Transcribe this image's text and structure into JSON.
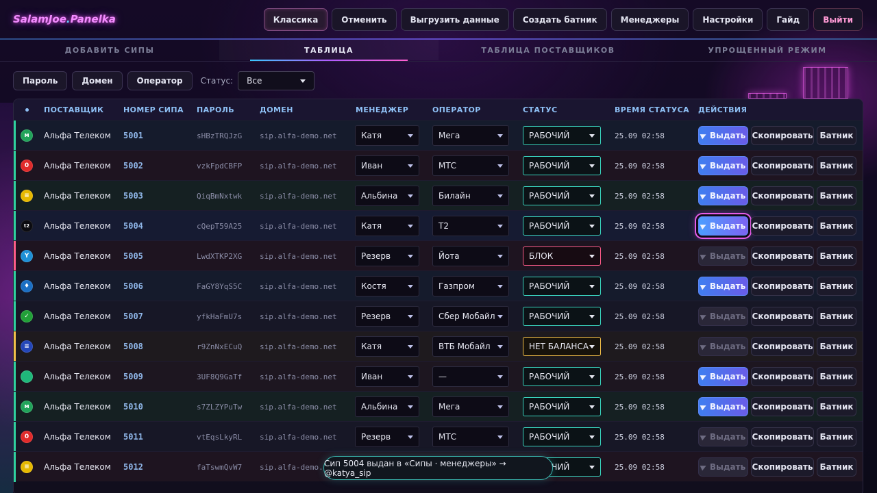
{
  "app": {
    "logo_main": "SalamJoe",
    "logo_dot": ".",
    "logo_tail": "Panelka"
  },
  "topnav": [
    {
      "id": "classic",
      "label": "Классика",
      "active": true
    },
    {
      "id": "undo",
      "label": "Отменить"
    },
    {
      "id": "export",
      "label": "Выгрузить данные"
    },
    {
      "id": "create-batnik",
      "label": "Создать батник"
    },
    {
      "id": "managers",
      "label": "Менеджеры"
    },
    {
      "id": "settings",
      "label": "Настройки"
    },
    {
      "id": "guide",
      "label": "Гайд"
    },
    {
      "id": "logout",
      "label": "Выйти"
    }
  ],
  "tabs": [
    {
      "label": "ДОБАВИТЬ СИПЫ"
    },
    {
      "label": "ТАБЛИЦА",
      "active": true
    },
    {
      "label": "ТАБЛИЦА ПОСТАВЩИКОВ"
    },
    {
      "label": "УПРОЩЕННЫЙ РЕЖИМ"
    }
  ],
  "filters": {
    "buttons": [
      "Пароль",
      "Домен",
      "Оператор"
    ],
    "status_label": "Статус:",
    "status_value": "Все"
  },
  "table": {
    "headers": [
      "•",
      "ПОСТАВЩИК",
      "НОМЕР СИПА",
      "ПАРОЛЬ",
      "ДОМЕН",
      "МЕНЕДЖЕР",
      "ОПЕРАТОР",
      "СТАТУС",
      "ВРЕМЯ СТАТУСА",
      "ДЕЙСТВИЯ"
    ],
    "actions": {
      "issue": "Выдать",
      "copy": "Скопировать",
      "batnik": "Батник"
    },
    "rows": [
      {
        "supplier": "Альфа Телеком",
        "sip": "5001",
        "password": "sHBzTRQJzG",
        "domain": "sip.alfa-demo.net",
        "manager": "Катя",
        "operator": "Мега",
        "status": "РАБОЧИЙ",
        "time": "25.09 02:58",
        "icon": "megafon-icon",
        "icon_glyph": "ᴍ",
        "icon_color": "#21a35a",
        "row_tint": "#151b2c",
        "edge": "#2fd2a0",
        "issue_enabled": true
      },
      {
        "supplier": "Альфа Телеком",
        "sip": "5002",
        "password": "vzkFpdCBFP",
        "domain": "sip.alfa-demo.net",
        "manager": "Иван",
        "operator": "МТС",
        "status": "РАБОЧИЙ",
        "time": "25.09 02:58",
        "icon": "mts-icon",
        "icon_glyph": "0",
        "icon_color": "#e02a2a",
        "row_tint": "#1e1420",
        "edge": "#2fd2a0",
        "issue_enabled": true
      },
      {
        "supplier": "Альфа Телеком",
        "sip": "5003",
        "password": "QiqBmNxtwk",
        "domain": "sip.alfa-demo.net",
        "manager": "Альбина",
        "operator": "Билайн",
        "status": "РАБОЧИЙ",
        "time": "25.09 02:58",
        "icon": "beeline-icon",
        "icon_glyph": "≡",
        "icon_color": "#e6b800",
        "row_tint": "#152022",
        "edge": "#2fd2a0",
        "issue_enabled": true
      },
      {
        "supplier": "Альфа Телеком",
        "sip": "5004",
        "password": "cQepT59A25",
        "domain": "sip.alfa-demo.net",
        "manager": "Катя",
        "operator": "Т2",
        "status": "РАБОЧИЙ",
        "time": "25.09 02:58",
        "icon": "t2-icon",
        "icon_glyph": "t2",
        "icon_color": "#0b0b10",
        "row_tint": "#161b32",
        "edge": "#2fd2a0",
        "issue_enabled": true,
        "focused": true
      },
      {
        "supplier": "Альфа Телеком",
        "sip": "5005",
        "password": "LwdXTKP2XG",
        "domain": "sip.alfa-demo.net",
        "manager": "Резерв",
        "operator": "Йота",
        "status": "БЛОК",
        "status_kind": "blok",
        "time": "25.09 02:58",
        "icon": "yota-icon",
        "icon_glyph": "Y",
        "icon_color": "#1e90d6",
        "row_tint": "#1e1420",
        "edge": "#ff5c8a",
        "issue_enabled": false
      },
      {
        "supplier": "Альфа Телеком",
        "sip": "5006",
        "password": "FaGY8YqS5C",
        "domain": "sip.alfa-demo.net",
        "manager": "Костя",
        "operator": "Газпром",
        "status": "РАБОЧИЙ",
        "time": "25.09 02:58",
        "icon": "gazprom-icon",
        "icon_glyph": "♦",
        "icon_color": "#1a6fc4",
        "row_tint": "#151b2c",
        "edge": "#2fd2a0",
        "issue_enabled": true
      },
      {
        "supplier": "Альфа Телеком",
        "sip": "5007",
        "password": "yfkHaFmU7s",
        "domain": "sip.alfa-demo.net",
        "manager": "Резерв",
        "operator": "Сбер Мобайл",
        "status": "РАБОЧИЙ",
        "time": "25.09 02:58",
        "icon": "sber-icon",
        "icon_glyph": "✓",
        "icon_color": "#21a038",
        "row_tint": "#171726",
        "edge": "#2fd2a0",
        "issue_enabled": false
      },
      {
        "supplier": "Альфа Телеком",
        "sip": "5008",
        "password": "r9ZnNxECuQ",
        "domain": "sip.alfa-demo.net",
        "manager": "Катя",
        "operator": "ВТБ Мобайл",
        "status": "НЕТ БАЛАНСА",
        "status_kind": "nobal",
        "time": "25.09 02:58",
        "icon": "vtb-icon",
        "icon_glyph": "≡",
        "icon_color": "#2346b8",
        "row_tint": "#1e1a1e",
        "edge": "#f4c04a",
        "issue_enabled": false
      },
      {
        "supplier": "Альфа Телеком",
        "sip": "5009",
        "password": "3UF8Q9GaTf",
        "domain": "sip.alfa-demo.net",
        "manager": "Иван",
        "operator": "—",
        "status": "РАБОЧИЙ",
        "time": "25.09 02:58",
        "icon": "green-dot-icon",
        "icon_glyph": "",
        "icon_color": "#1fb87a",
        "row_tint": "#1d1620",
        "edge": "#2fd2a0",
        "issue_enabled": true
      },
      {
        "supplier": "Альфа Телеком",
        "sip": "5010",
        "password": "s7ZLZYPuTw",
        "domain": "sip.alfa-demo.net",
        "manager": "Альбина",
        "operator": "Мега",
        "status": "РАБОЧИЙ",
        "time": "25.09 02:58",
        "icon": "megafon-icon",
        "icon_glyph": "ᴍ",
        "icon_color": "#21a35a",
        "row_tint": "#152022",
        "edge": "#2fd2a0",
        "issue_enabled": true
      },
      {
        "supplier": "Альфа Телеком",
        "sip": "5011",
        "password": "vtEqsLkyRL",
        "domain": "sip.alfa-demo.net",
        "manager": "Резерв",
        "operator": "МТС",
        "status": "РАБОЧИЙ",
        "time": "25.09 02:58",
        "icon": "mts-icon",
        "icon_glyph": "0",
        "icon_color": "#e02a2a",
        "row_tint": "#171726",
        "edge": "#2fd2a0",
        "issue_enabled": false
      },
      {
        "supplier": "Альфа Телеком",
        "sip": "5012",
        "password": "faTswmQvW7",
        "domain": "sip.alfa-demo.net",
        "manager": "",
        "operator": "",
        "status": "РАБОЧИЙ",
        "time": "25.09 02:58",
        "icon": "beeline-icon",
        "icon_glyph": "≡",
        "icon_color": "#e6b800",
        "row_tint": "#1e1420",
        "edge": "#2fd2a0",
        "issue_enabled": false
      }
    ]
  },
  "toast": {
    "text": "Сип 5004 выдан в «Сипы · менеджеры» → @katya_sip"
  }
}
